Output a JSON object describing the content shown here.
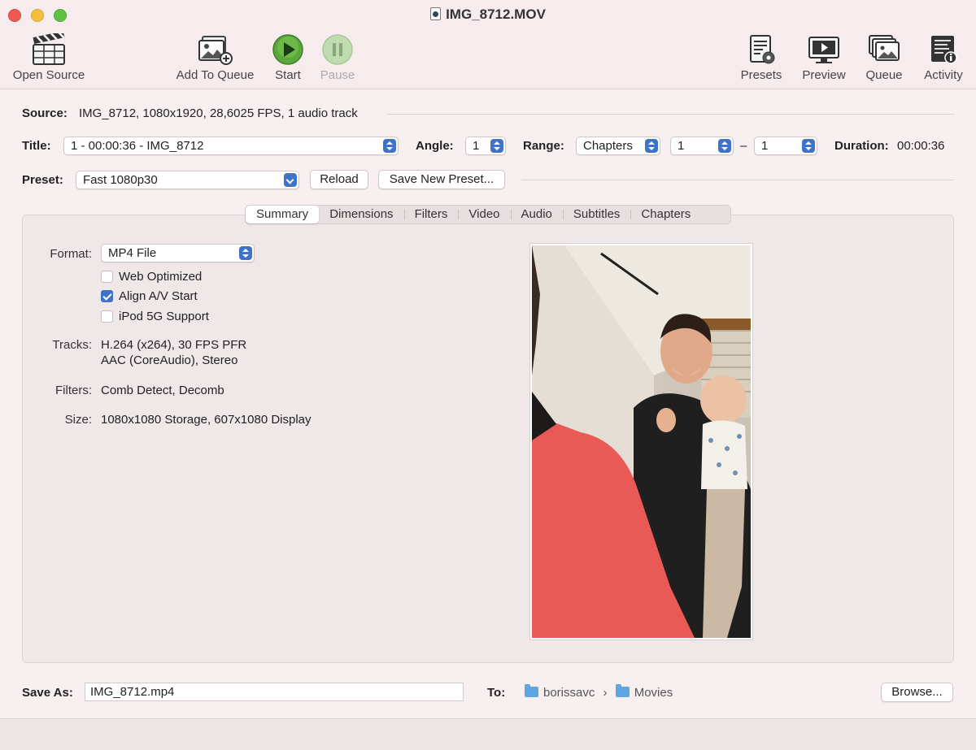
{
  "window": {
    "title": "IMG_8712.MOV"
  },
  "toolbar": {
    "open_source": "Open Source",
    "add_to_queue": "Add To Queue",
    "start": "Start",
    "pause": "Pause",
    "presets": "Presets",
    "preview": "Preview",
    "queue": "Queue",
    "activity": "Activity"
  },
  "source": {
    "label": "Source:",
    "value": "IMG_8712, 1080x1920, 28,6025 FPS, 1 audio track"
  },
  "title_row": {
    "title_label": "Title:",
    "title_value": "1 - 00:00:36 - IMG_8712",
    "angle_label": "Angle:",
    "angle_value": "1",
    "range_label": "Range:",
    "range_type": "Chapters",
    "range_start": "1",
    "range_dash": "–",
    "range_end": "1",
    "duration_label": "Duration:",
    "duration_value": "00:00:36"
  },
  "preset_row": {
    "label": "Preset:",
    "value": "Fast 1080p30",
    "reload": "Reload",
    "save_new": "Save New Preset..."
  },
  "tabs": [
    "Summary",
    "Dimensions",
    "Filters",
    "Video",
    "Audio",
    "Subtitles",
    "Chapters"
  ],
  "summary": {
    "format_label": "Format:",
    "format_value": "MP4 File",
    "web_optimized": "Web Optimized",
    "align_av": "Align A/V Start",
    "ipod": "iPod 5G Support",
    "tracks_label": "Tracks:",
    "tracks_line1": "H.264 (x264), 30 FPS PFR",
    "tracks_line2": "AAC (CoreAudio), Stereo",
    "filters_label": "Filters:",
    "filters_value": "Comb Detect, Decomb",
    "size_label": "Size:",
    "size_value": "1080x1080 Storage, 607x1080 Display"
  },
  "save": {
    "label": "Save As:",
    "value": "IMG_8712.mp4",
    "to_label": "To:",
    "folder1": "borissavc",
    "sep": "›",
    "folder2": "Movies",
    "browse": "Browse..."
  },
  "colors": {
    "accent": "#3f73c9",
    "start_green": "#5aa83c",
    "window_bg": "#f8eff0"
  }
}
